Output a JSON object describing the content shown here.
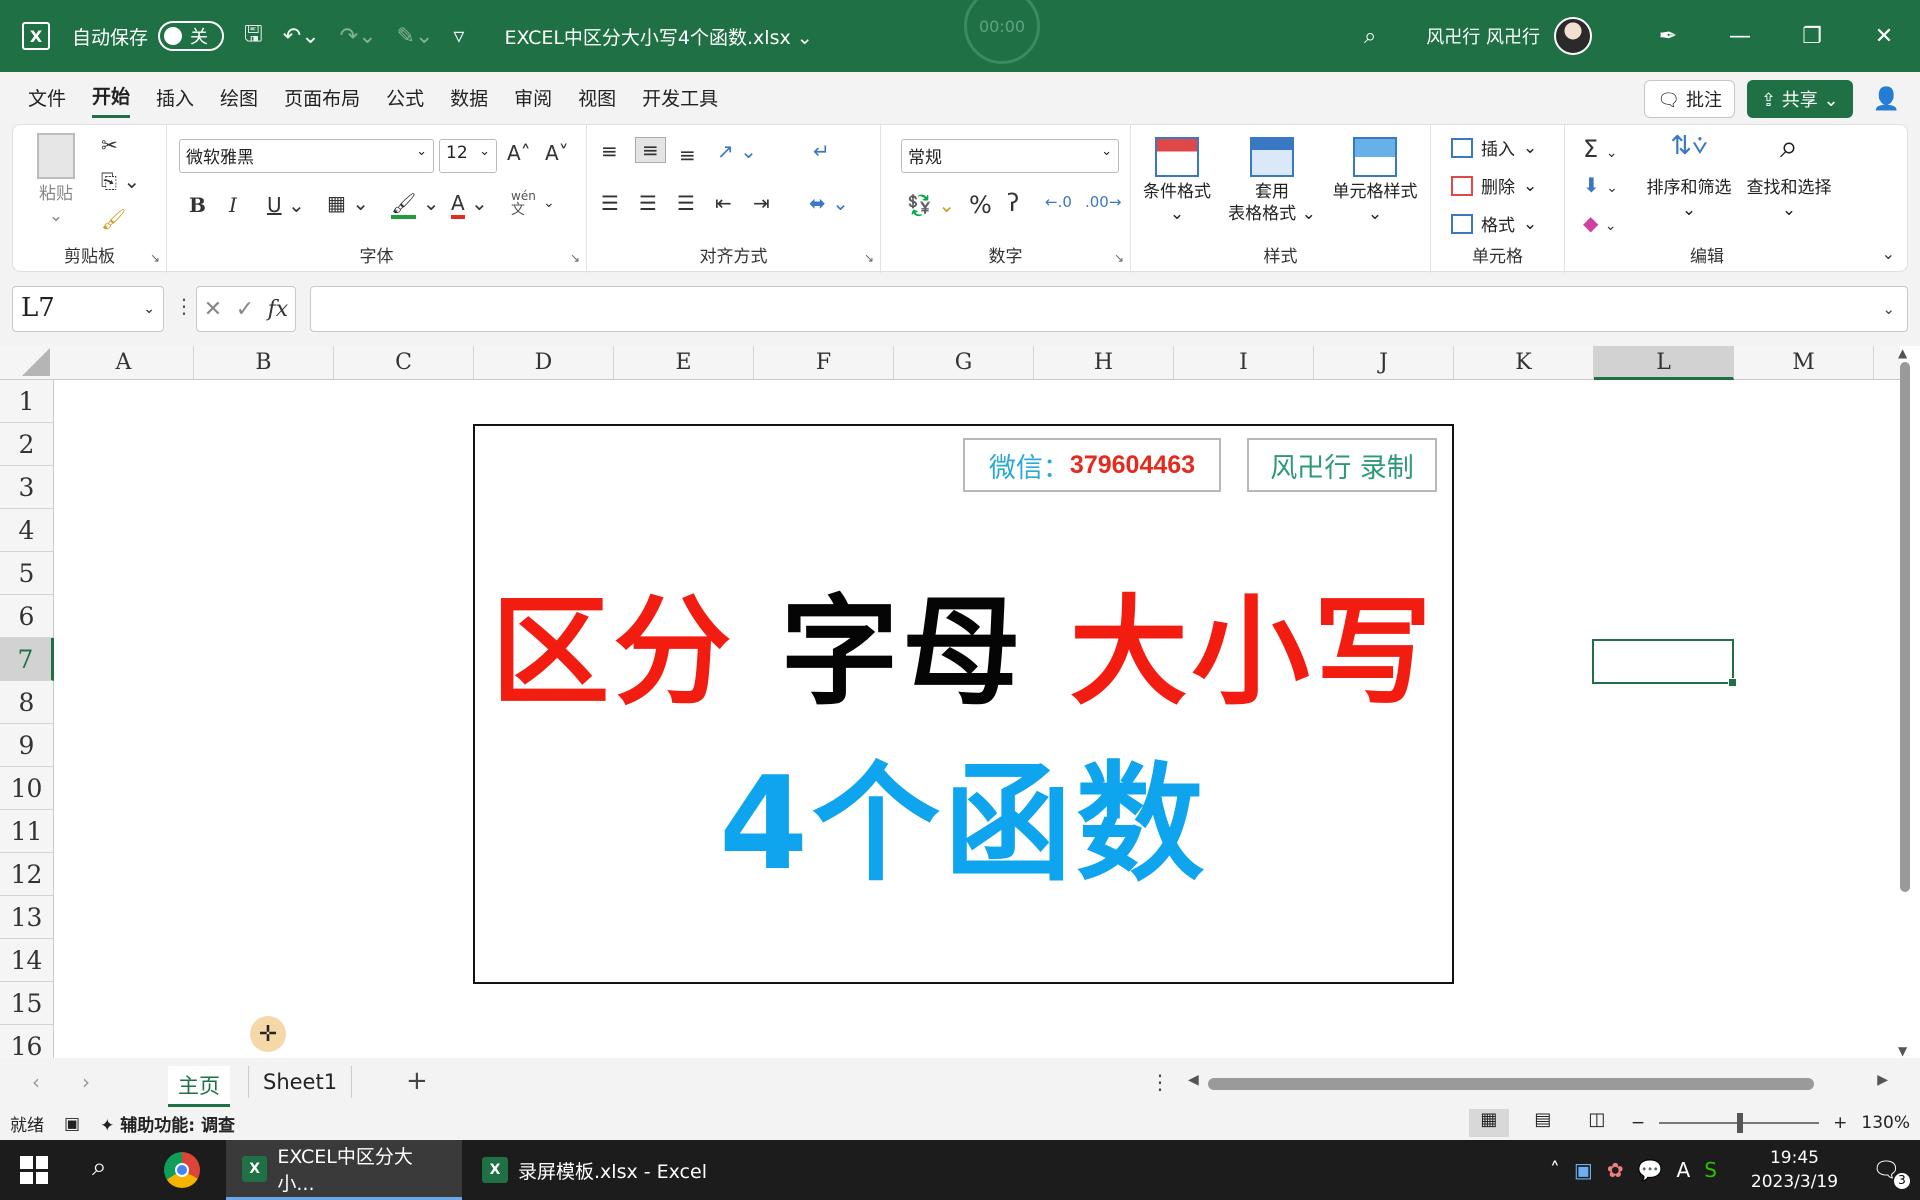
{
  "titlebar": {
    "autosave_label": "自动保存",
    "autosave_state": "关",
    "doc_title": "EXCEL中区分大小写4个函数.xlsx",
    "recorder_time": "00:00",
    "user_name": "风卍行 风卍行"
  },
  "menu": [
    "文件",
    "开始",
    "插入",
    "绘图",
    "页面布局",
    "公式",
    "数据",
    "审阅",
    "视图",
    "开发工具"
  ],
  "menu_active": "开始",
  "menu_right": {
    "comments": "批注",
    "share": "共享"
  },
  "ribbon": {
    "clipboard": {
      "label": "剪贴板",
      "paste": "粘贴"
    },
    "font": {
      "label": "字体",
      "font_name": "微软雅黑",
      "font_size": "12",
      "bold": "B",
      "italic": "I",
      "underline": "U",
      "phonetic_top": "wén",
      "phonetic_bottom": "文"
    },
    "alignment": {
      "label": "对齐方式"
    },
    "number": {
      "label": "数字",
      "format": "常规"
    },
    "styles": {
      "label": "样式",
      "conditional": "条件格式",
      "table_l1": "套用",
      "table_l2": "表格格式",
      "cell_styles": "单元格样式"
    },
    "cells": {
      "label": "单元格",
      "insert": "插入",
      "delete": "删除",
      "format": "格式"
    },
    "editing": {
      "label": "编辑",
      "sort_filter": "排序和筛选",
      "find_select": "查找和选择"
    }
  },
  "formula": {
    "name_box": "L7",
    "content": ""
  },
  "columns": [
    "A",
    "B",
    "C",
    "D",
    "E",
    "F",
    "G",
    "H",
    "I",
    "J",
    "K",
    "L",
    "M"
  ],
  "selected_column": "L",
  "rows": [
    "1",
    "2",
    "3",
    "4",
    "5",
    "6",
    "7",
    "8",
    "9",
    "10",
    "11",
    "12",
    "13",
    "14",
    "15",
    "16"
  ],
  "selected_row": "7",
  "banner": {
    "wechat_label": "微信：",
    "wechat_id": "379604463",
    "author": "风卍行 录制",
    "line1_a": "区分",
    "line1_b": "字母",
    "line1_c": "大小写",
    "line2": "4个函数",
    "colors": {
      "red": "#f21d10",
      "black": "#050505",
      "blue": "#0ea4ee"
    }
  },
  "sheets": {
    "tabs": [
      "主页",
      "Sheet1"
    ],
    "active": "主页"
  },
  "status": {
    "ready": "就绪",
    "accessibility": "辅助功能: 调查",
    "zoom": "130%"
  },
  "taskbar": {
    "task1": "EXCEL中区分大小...",
    "task2": "录屏模板.xlsx - Excel",
    "time": "19:45",
    "date": "2023/3/19",
    "notifications": "3"
  },
  "accent_color": "#1f7145"
}
